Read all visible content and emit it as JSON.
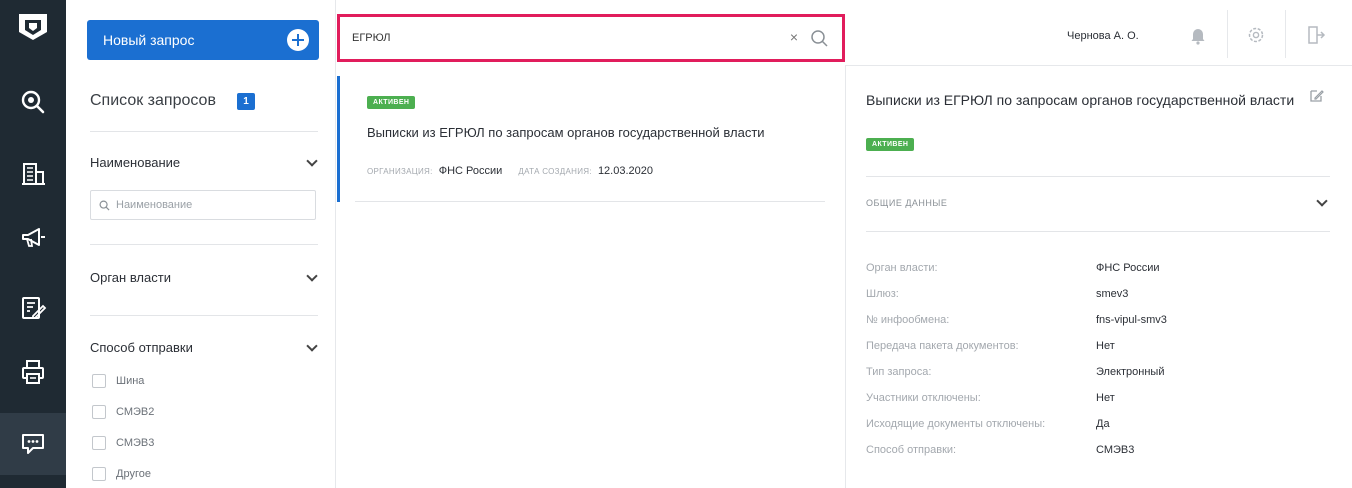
{
  "rail": {
    "items": [
      {
        "name": "search"
      },
      {
        "name": "building"
      },
      {
        "name": "megaphone"
      },
      {
        "name": "document-edit"
      },
      {
        "name": "printer"
      },
      {
        "name": "chat"
      }
    ]
  },
  "sidebar": {
    "new_request_label": "Новый запрос",
    "list_title": "Список запросов",
    "list_count": "1",
    "filters": {
      "name_label": "Наименование",
      "name_placeholder": "Наименование",
      "authority_label": "Орган власти",
      "send_method_label": "Способ отправки",
      "send_options": [
        "Шина",
        "СМЭВ2",
        "СМЭВ3",
        "Другое"
      ]
    }
  },
  "search": {
    "value": "ЕГРЮЛ",
    "clear_symbol": "×"
  },
  "results": [
    {
      "status": "АКТИВЕН",
      "title": "Выписки из ЕГРЮЛ по запросам органов государственной власти",
      "org_label": "ОРГАНИЗАЦИЯ:",
      "org_value": "ФНС России",
      "date_label": "ДАТА СОЗДАНИЯ:",
      "date_value": "12.03.2020"
    }
  ],
  "topbar": {
    "user_name": "Чернова А. О."
  },
  "detail": {
    "title": "Выписки из ЕГРЮЛ по запросам органов государственной власти",
    "status": "АКТИВЕН",
    "section_title": "ОБЩИЕ ДАННЫЕ",
    "rows": [
      {
        "key": "Орган власти:",
        "value": "ФНС России"
      },
      {
        "key": "Шлюз:",
        "value": "smev3"
      },
      {
        "key": "№ инфообмена:",
        "value": "fns-vipul-smv3"
      },
      {
        "key": "Передача пакета документов:",
        "value": "Нет"
      },
      {
        "key": "Тип запроса:",
        "value": "Электронный"
      },
      {
        "key": "Участники отключены:",
        "value": "Нет"
      },
      {
        "key": "Исходящие документы отключены:",
        "value": "Да"
      },
      {
        "key": "Способ отправки:",
        "value": "СМЭВ3"
      }
    ]
  },
  "colors": {
    "rail_bg": "#1f2a33",
    "accent_blue": "#1b6fd1",
    "active_green": "#4caf50",
    "search_highlight": "#e11d5c"
  }
}
